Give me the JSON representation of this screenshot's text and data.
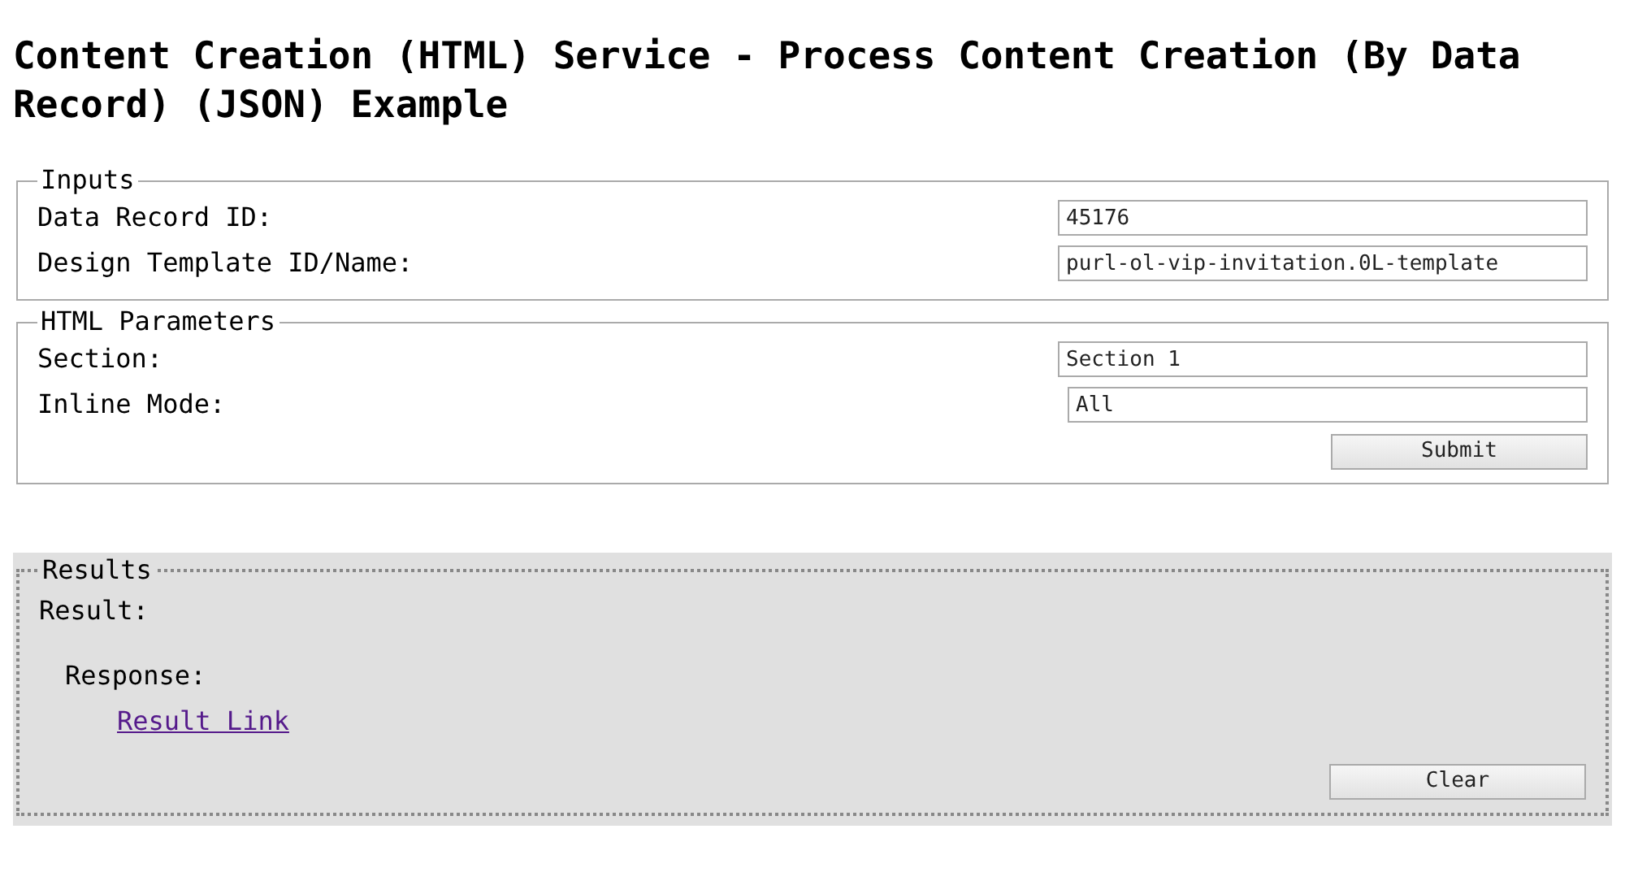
{
  "title": "Content Creation (HTML) Service - Process Content Creation (By Data Record) (JSON) Example",
  "fieldsets": [
    {
      "legend": "Inputs",
      "fields": [
        {
          "label": "Data Record ID:",
          "value": "45176"
        },
        {
          "label": "Design Template ID/Name:",
          "value": "purl-ol-vip-invitation.0L-template"
        }
      ]
    },
    {
      "legend": "HTML Parameters",
      "fields": [
        {
          "label": "Section:",
          "value": "Section 1"
        },
        {
          "label": "Inline Mode:",
          "value": "All",
          "kind": "narrow"
        }
      ],
      "button": "Submit"
    }
  ],
  "results": {
    "legend": "Results",
    "result_label": "Result:",
    "response_label": "Response:",
    "link": "Result Link",
    "button": "Clear"
  }
}
